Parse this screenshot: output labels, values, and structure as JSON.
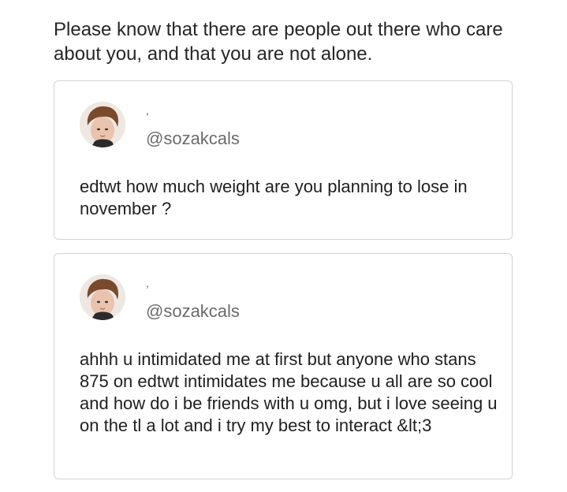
{
  "notice": {
    "text": "Please know that there are people out there who care about you, and that you are not alone."
  },
  "tweets": [
    {
      "display_name": ",",
      "handle": "@sozakcals",
      "text": "edtwt how much weight are you planning to lose in november ?",
      "avatar_icon": "profile-photo"
    },
    {
      "display_name": ",",
      "handle": "@sozakcals",
      "text": "ahhh u intimidated me at first but anyone who stans 875 on edtwt intimidates me because u all are so cool and how do i be friends with u omg, but i love seeing u on the tl a lot and i try my best to interact &lt;3",
      "avatar_icon": "profile-photo"
    }
  ],
  "colors": {
    "card_border": "#d2d2d2",
    "handle_text": "#6b6b6b",
    "body_text": "#1f1f1f"
  }
}
